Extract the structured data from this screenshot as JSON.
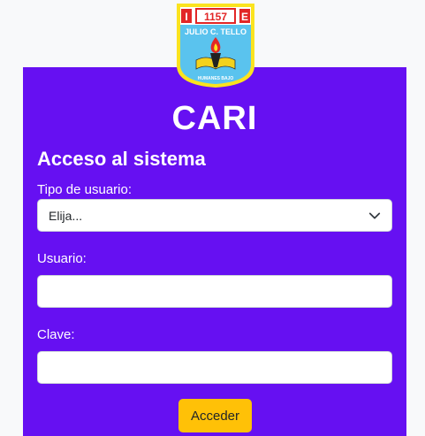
{
  "logo": {
    "badge_left": "I",
    "badge_number": "1157",
    "badge_right": "E",
    "school_name": "JULIO C. TELLO",
    "motto": "HUMANES BAJO"
  },
  "app": {
    "title": "CARI"
  },
  "form": {
    "heading": "Acceso al sistema",
    "user_type_label": "Tipo de usuario:",
    "user_type_selected": "Elija...",
    "username_label": "Usuario:",
    "username_value": "",
    "password_label": "Clave:",
    "password_value": "",
    "submit_label": "Acceder"
  },
  "colors": {
    "panel": "#6610f2",
    "button": "#ffc107",
    "background": "#f8f9fa"
  }
}
